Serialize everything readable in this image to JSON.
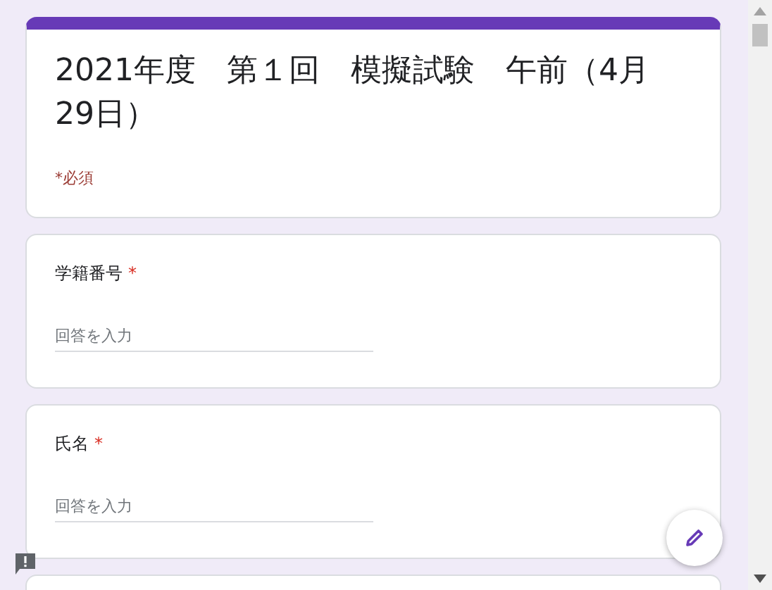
{
  "form": {
    "title": "2021年度　第１回　模擬試験　午前（4月29日）",
    "required_note": "*必須"
  },
  "questions": [
    {
      "label": "学籍番号",
      "required_mark": "*",
      "placeholder": "回答を入力"
    },
    {
      "label": "氏名",
      "required_mark": "*",
      "placeholder": "回答を入力"
    }
  ]
}
